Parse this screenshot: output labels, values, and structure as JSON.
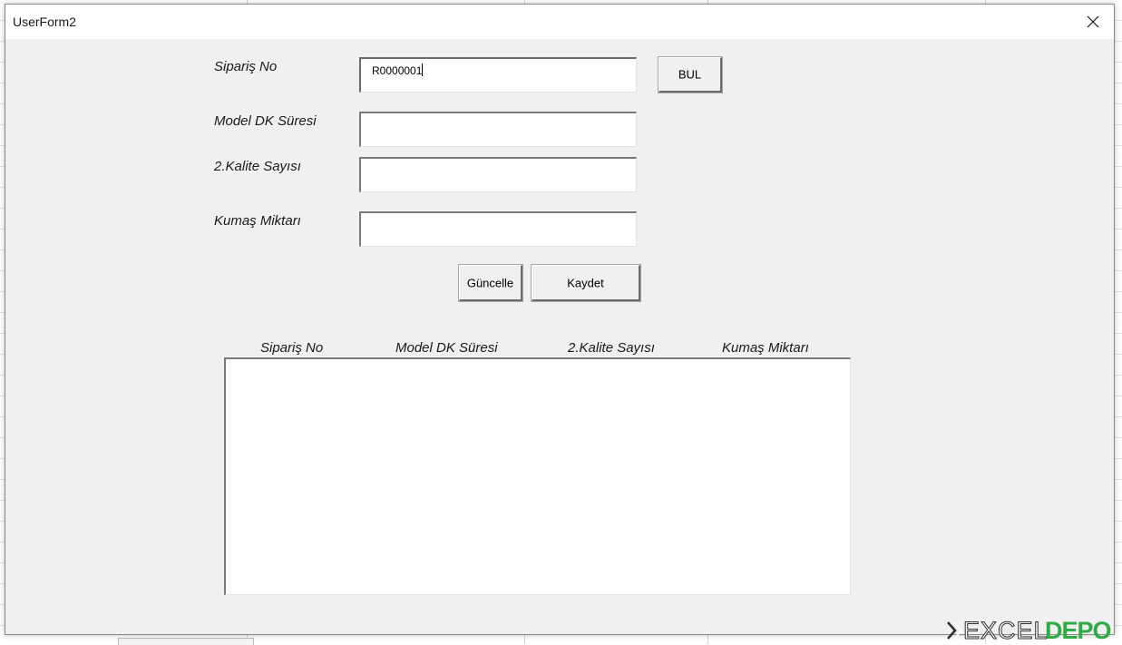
{
  "window": {
    "title": "UserForm2"
  },
  "form": {
    "fields": [
      {
        "label": "Sipariş No",
        "value": "R0000001"
      },
      {
        "label": "Model DK Süresi",
        "value": ""
      },
      {
        "label": "2.Kalite Sayısı",
        "value": ""
      },
      {
        "label": "Kumaş Miktarı",
        "value": ""
      }
    ],
    "buttons": {
      "find": "BUL",
      "update": "Güncelle",
      "save": "Kaydet"
    }
  },
  "list": {
    "columns": [
      "Sipariş No",
      "Model DK Süresi",
      "2.Kalite Sayısı",
      "Kumaş Miktarı"
    ],
    "rows": []
  },
  "watermark": {
    "part1": "EXCEL",
    "part2": "DEPO"
  },
  "colors": {
    "form_background": "#f0f0f0",
    "titlebar": "#ffffff",
    "watermark_green": "#2eaa46"
  }
}
